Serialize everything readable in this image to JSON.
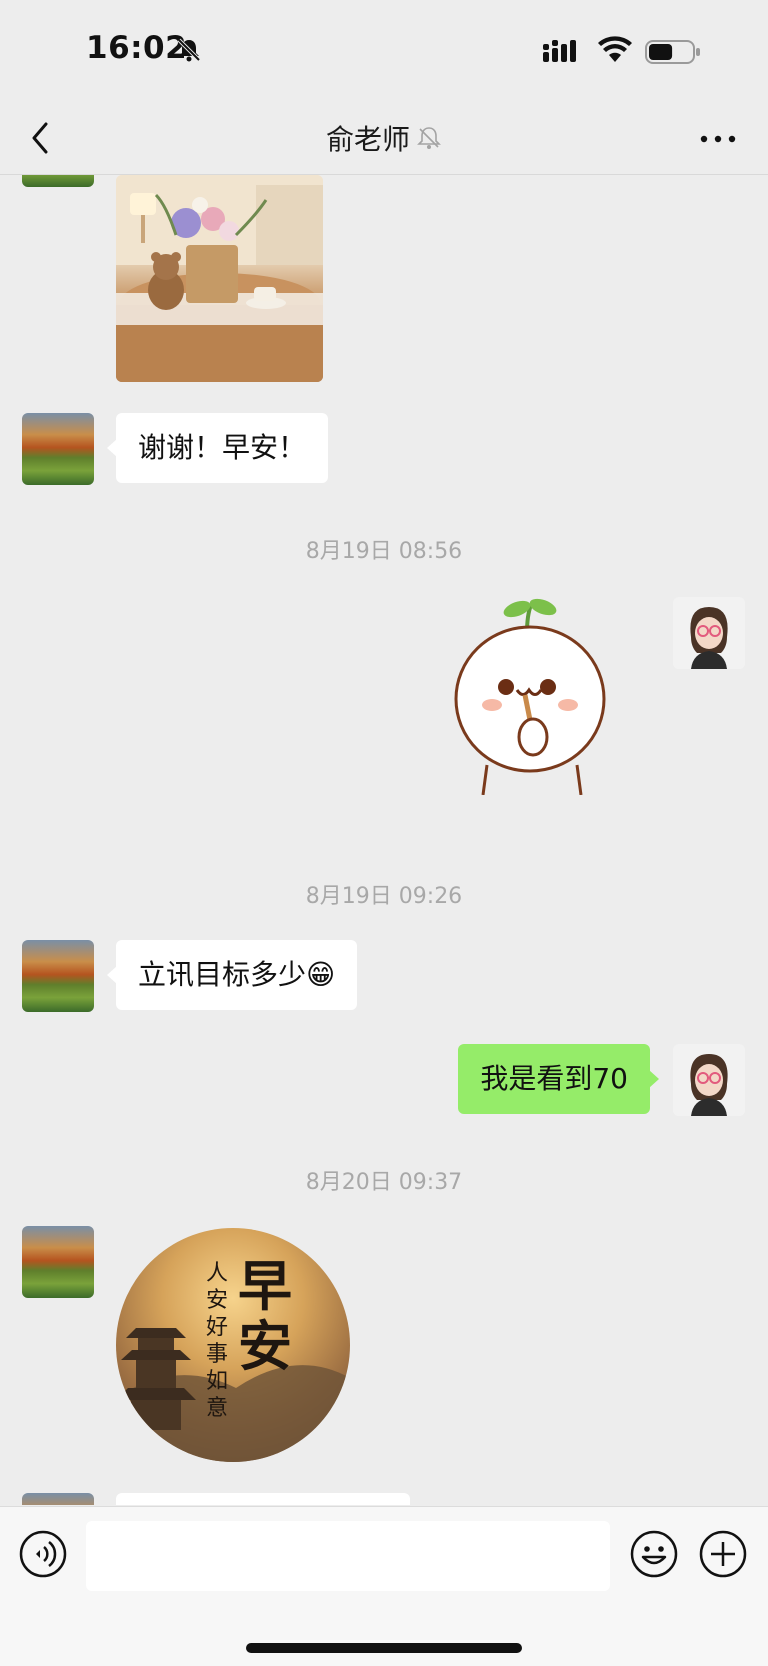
{
  "status_bar": {
    "time": "16:02",
    "battery_level": 0.55
  },
  "nav": {
    "title": "俞老师"
  },
  "messages": [
    {
      "side": "left",
      "type": "image",
      "image": "teddy-bear-flowers-photo"
    },
    {
      "side": "left",
      "type": "text",
      "text": "谢谢！早安！"
    },
    {
      "type": "timestamp",
      "text": "8月19日 08:56"
    },
    {
      "side": "right",
      "type": "sticker",
      "image": "sprout-character-sticker"
    },
    {
      "type": "timestamp",
      "text": "8月19日 09:26"
    },
    {
      "side": "left",
      "type": "text",
      "text": "立讯目标多少😁"
    },
    {
      "side": "right",
      "type": "text",
      "text": "我是看到70"
    },
    {
      "type": "timestamp",
      "text": "8月20日 09:37"
    },
    {
      "side": "left",
      "type": "image",
      "image": "good-morning-pagoda-image",
      "overlay_big": "早安",
      "overlay_small": "人安好事如意"
    }
  ],
  "icons": {
    "mute": "bell-slash-icon",
    "back": "chevron-left-icon",
    "more": "ellipsis-icon",
    "voice": "voice-icon",
    "emoji": "emoji-icon",
    "plus": "plus-circle-icon"
  },
  "colors": {
    "background": "#ededed",
    "sent_bubble": "#95ec69",
    "received_bubble": "#ffffff",
    "timestamp": "#a8a8a8"
  }
}
